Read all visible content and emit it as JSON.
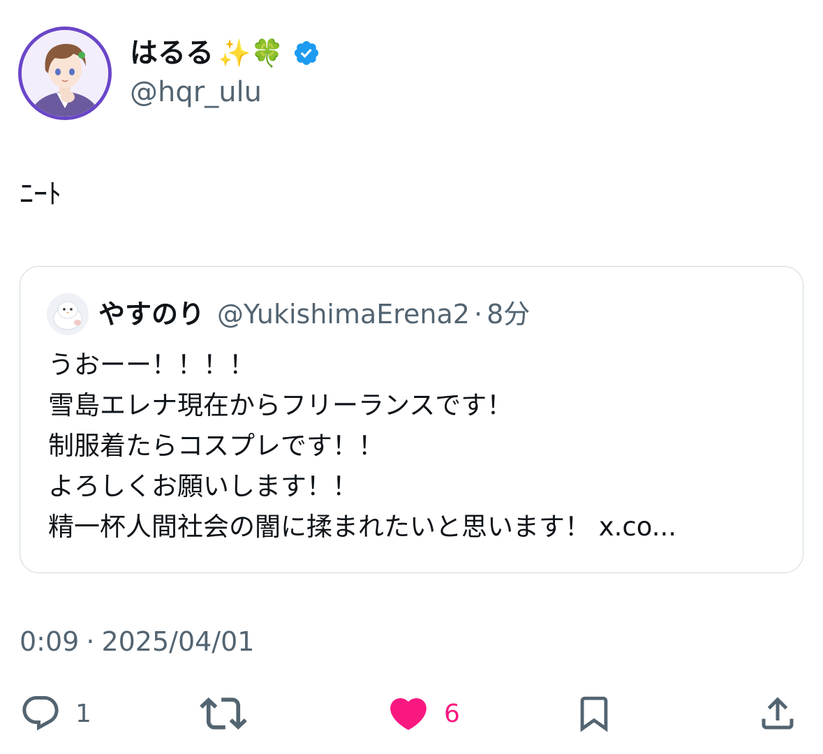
{
  "author": {
    "display_name": "はるる",
    "name_emojis": "✨🍀",
    "handle": "@hqr_ulu",
    "verified": true
  },
  "tweet": {
    "text": "ﾆｰﾄ"
  },
  "quote": {
    "display_name": "やすのり",
    "handle": "@YukishimaErena2",
    "separator": "·",
    "time": "8分",
    "body": "うおーー！！！！\n雪島エレナ現在からフリーランスです！\n制服着たらコスプレです！！\nよろしくお願いします！！\n精一杯人間社会の闇に揉まれたいと思います！ x.co..."
  },
  "meta": {
    "time": "0:09",
    "separator": "·",
    "date": "2025/04/01"
  },
  "actions": {
    "reply_count": "1",
    "like_count": "6",
    "like_color": "#f91880",
    "icons": [
      "reply-icon",
      "retweet-icon",
      "like-icon",
      "bookmark-icon",
      "share-icon"
    ]
  },
  "colors": {
    "verified": "#1d9bf0",
    "secondary_text": "#536471",
    "avatar_ring": "#6a46c8"
  }
}
